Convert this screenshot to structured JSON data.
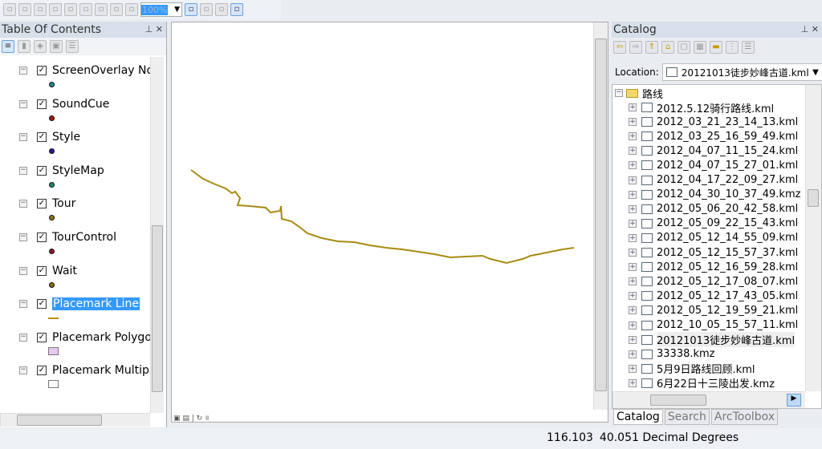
{
  "toolbar": {
    "zoom_value": "100%",
    "icons": [
      "zoom-in-icon",
      "zoom-out-icon",
      "pan-icon",
      "full-extent-icon",
      "fixed-zoom-icon",
      "zoom-whole-page-icon",
      "zoom-extent-icon",
      "back-icon",
      "forward-icon",
      "layout-toggle-icon",
      "focus-frame-icon",
      "change-layout-icon",
      "data-driven-pages-icon"
    ]
  },
  "toc": {
    "title": "Table Of Contents",
    "layers": [
      {
        "name": "ScreenOverlay NoG",
        "symbol": "point",
        "color": "#1a8c8c"
      },
      {
        "name": "SoundCue",
        "symbol": "point",
        "color": "#a01a10"
      },
      {
        "name": "Style",
        "symbol": "point",
        "color": "#2a1a9a"
      },
      {
        "name": "StyleMap",
        "symbol": "point",
        "color": "#1a8c6c"
      },
      {
        "name": "Tour",
        "symbol": "point",
        "color": "#8c7a10"
      },
      {
        "name": "TourControl",
        "symbol": "point",
        "color": "#8c1a2a"
      },
      {
        "name": "Wait",
        "symbol": "point",
        "color": "#8c6a10"
      },
      {
        "name": "Placemark Line",
        "symbol": "line",
        "color": "#b8900a",
        "selected": true
      },
      {
        "name": "Placemark Polygon",
        "symbol": "polygon",
        "color": "#e6c8f0"
      },
      {
        "name": "Placemark Multipat",
        "symbol": "polygon",
        "color": "#ffffff"
      }
    ]
  },
  "map": {
    "line_color": "#a88a10"
  },
  "catalog": {
    "title": "Catalog",
    "location_label": "Location:",
    "location_value": "20121013徒步妙峰古道.kml",
    "folder": "路线",
    "items": [
      "2012.5.12骑行路线.kml",
      "2012_03_21_23_14_13.kml",
      "2012_03_25_16_59_49.kml",
      "2012_04_07_11_15_24.kml",
      "2012_04_07_15_27_01.kml",
      "2012_04_17_22_09_27.kml",
      "2012_04_30_10_37_49.kmz",
      "2012_05_06_20_42_58.kml",
      "2012_05_09_22_15_43.kml",
      "2012_05_12_14_55_09.kml",
      "2012_05_12_15_57_37.kml",
      "2012_05_12_16_59_28.kml",
      "2012_05_12_17_08_07.kml",
      "2012_05_12_17_43_05.kml",
      "2012_05_12_19_59_21.kml",
      "2012_10_05_15_57_11.kml",
      "20121013徒步妙峰古道.kml",
      "33338.kmz",
      "5月9日路线回顾.kml",
      "6月22日十三陵出发.kmz"
    ],
    "selected_index": 16,
    "tabs": [
      "Catalog",
      "Search",
      "ArcToolbox"
    ]
  },
  "status": {
    "x": "116.103",
    "y": "40.051",
    "units": "Decimal Degrees"
  }
}
